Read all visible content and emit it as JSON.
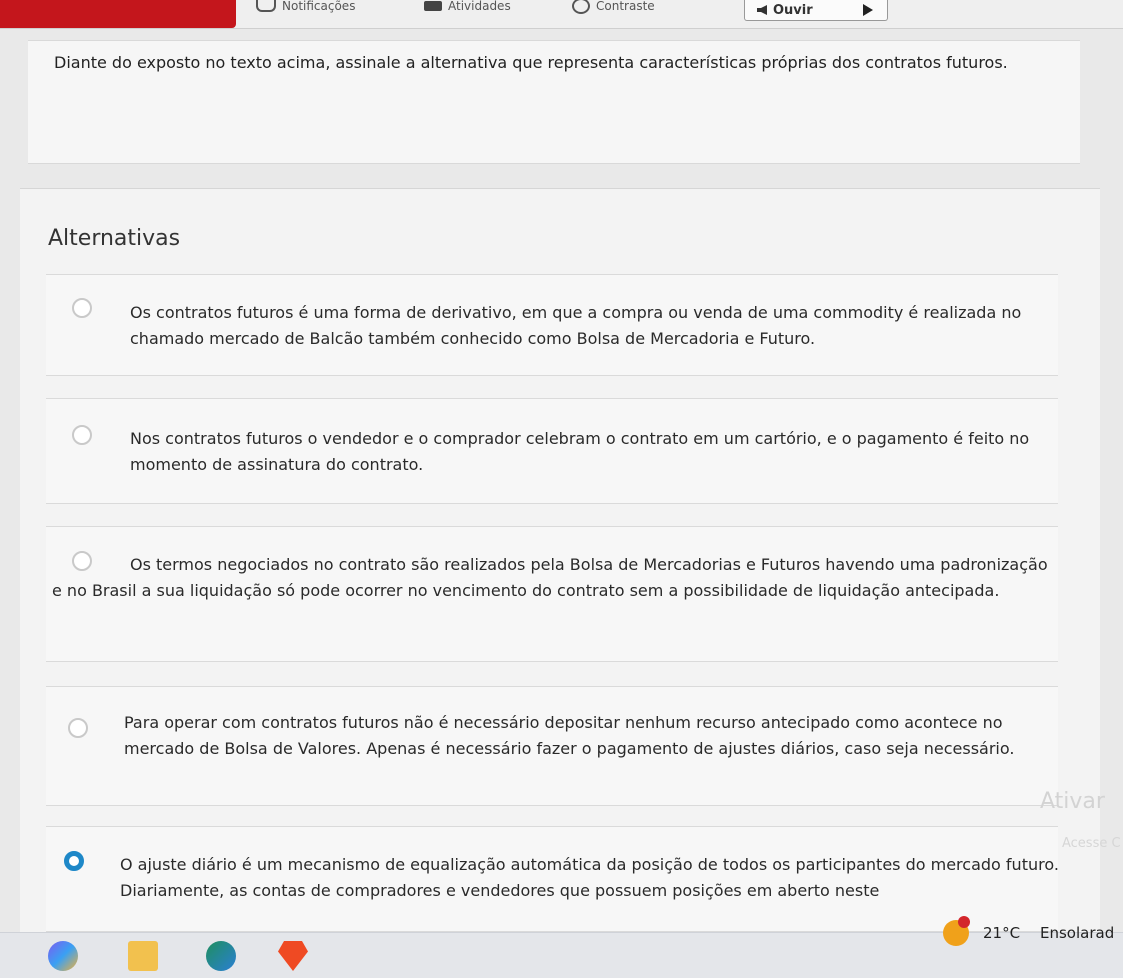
{
  "toolbar": {
    "notifications_label": "Notificações",
    "activities_label": "Atividades",
    "contrast_label": "Contraste",
    "listen_label": "Ouvir"
  },
  "question": {
    "text": "Diante do exposto no texto acima, assinale a alternativa que representa características próprias dos contratos futuros."
  },
  "alternatives": {
    "title": "Alternativas",
    "options": [
      {
        "text": "Os contratos futuros é uma forma de derivativo, em que a compra ou venda de uma commodity é realizada no chamado mercado de Balcão também conhecido como Bolsa de Mercadoria e Futuro.",
        "selected": false
      },
      {
        "text": "Nos contratos futuros o vendedor e o comprador celebram o contrato em um cartório, e o pagamento é feito no momento de assinatura do contrato.",
        "selected": false
      },
      {
        "text": "Os termos negociados no contrato são realizados pela Bolsa de Mercadorias e Futuros havendo uma padronização e no Brasil a sua liquidação só pode ocorrer no vencimento do contrato sem a possibilidade de liquidação antecipada.",
        "selected": false
      },
      {
        "text": "Para operar com contratos futuros não é necessário depositar nenhum recurso antecipado como acontece no mercado de Bolsa de Valores. Apenas é necessário fazer o pagamento de ajustes diários, caso seja necessário.",
        "selected": false
      },
      {
        "text": "O ajuste diário é um mecanismo de equalização automática da posição de todos os participantes do mercado futuro. Diariamente, as contas de compradores e vendedores que possuem posições em aberto neste",
        "selected": true
      }
    ]
  },
  "watermark": {
    "line1": "Ativar",
    "line2": "Acesse C"
  },
  "weather": {
    "temperature": "21°C",
    "condition": "Ensolarad"
  },
  "colors": {
    "accent": "#1e88c8",
    "brand": "#c4161c"
  }
}
